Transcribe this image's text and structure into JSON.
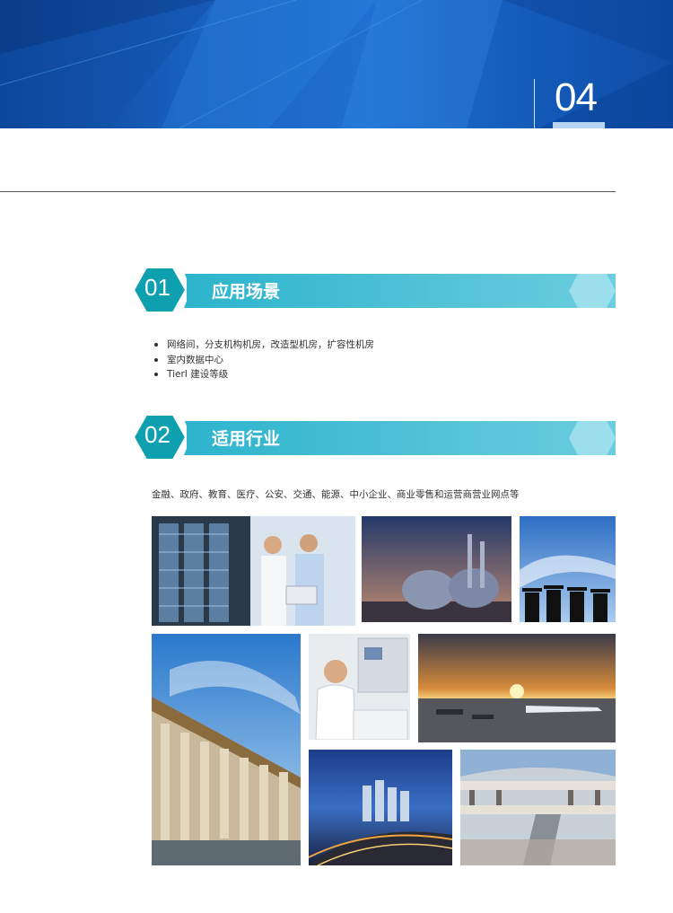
{
  "header": {
    "page_number": "04"
  },
  "sections": [
    {
      "number": "01",
      "title": "应用场景"
    },
    {
      "number": "02",
      "title": "适用行业"
    }
  ],
  "scenarios": [
    "网络间，分支机构机房，改造型机房，扩容性机房",
    "室内数据中心",
    "TierI 建设等级"
  ],
  "industries_text": "金融、政府、教育、医疗、公安、交通、能源、中小企业、商业零售和运营商营业网点等",
  "colors": {
    "banner_blue": "#1a63c2",
    "section_teal": "#3fb8d3",
    "hex_teal": "#12a6b5"
  },
  "photos": [
    {
      "subject": "server-room-engineers"
    },
    {
      "subject": "gas-storage-tanks"
    },
    {
      "subject": "graduates-sky"
    },
    {
      "subject": "government-building"
    },
    {
      "subject": "laboratory-doctor"
    },
    {
      "subject": "airport-sunset"
    },
    {
      "subject": "city-night"
    },
    {
      "subject": "shopping-mall"
    }
  ]
}
